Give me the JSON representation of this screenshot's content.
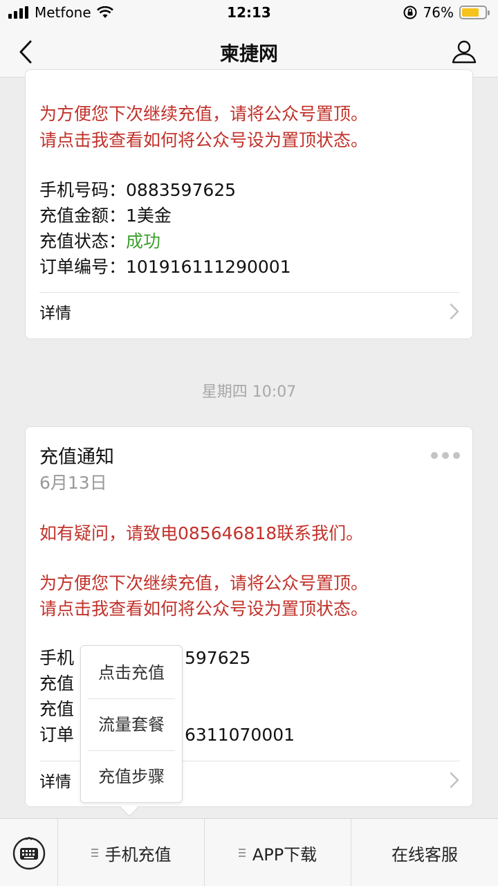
{
  "status_bar": {
    "carrier": "Metfone",
    "time": "12:13",
    "battery_percent": "76%",
    "battery_level": 0.76,
    "battery_color": "#f6c21c"
  },
  "nav": {
    "title": "柬捷网"
  },
  "card1": {
    "tip_line1": "为方便您下次继续充值，请将公众号置顶。",
    "tip_line2": "请点击我查看如何将公众号设为置顶状态。",
    "phone_label": "手机号码：",
    "phone_value": "0883597625",
    "amount_label": "充值金额：",
    "amount_value": "1美金",
    "state_label": "充值状态：",
    "state_value": "成功",
    "order_label": "订单编号：",
    "order_value": "101916111290001",
    "detail_label": "详情"
  },
  "timestamp": "星期四 10:07",
  "card2": {
    "title": "充值通知",
    "date": "6月13日",
    "contact_line": "如有疑问，请致电085646818联系我们。",
    "tip_line1": "为方便您下次继续充值，请将公众号置顶。",
    "tip_line2": "请点击我查看如何将公众号设为置顶状态。",
    "row1_left": "手机",
    "row1_right": "597625",
    "row2_left": "充值",
    "row3_left": "充值",
    "row4_left": "订单",
    "row4_right": "6311070001",
    "detail_label": "详情"
  },
  "popup_menu": {
    "items": [
      "点击充值",
      "流量套餐",
      "充值步骤"
    ]
  },
  "bottom_menu": {
    "items": [
      "手机充值",
      "APP下载",
      "在线客服"
    ]
  },
  "colors": {
    "highlight_red": "#c1312a",
    "success_green": "#3ca030"
  }
}
